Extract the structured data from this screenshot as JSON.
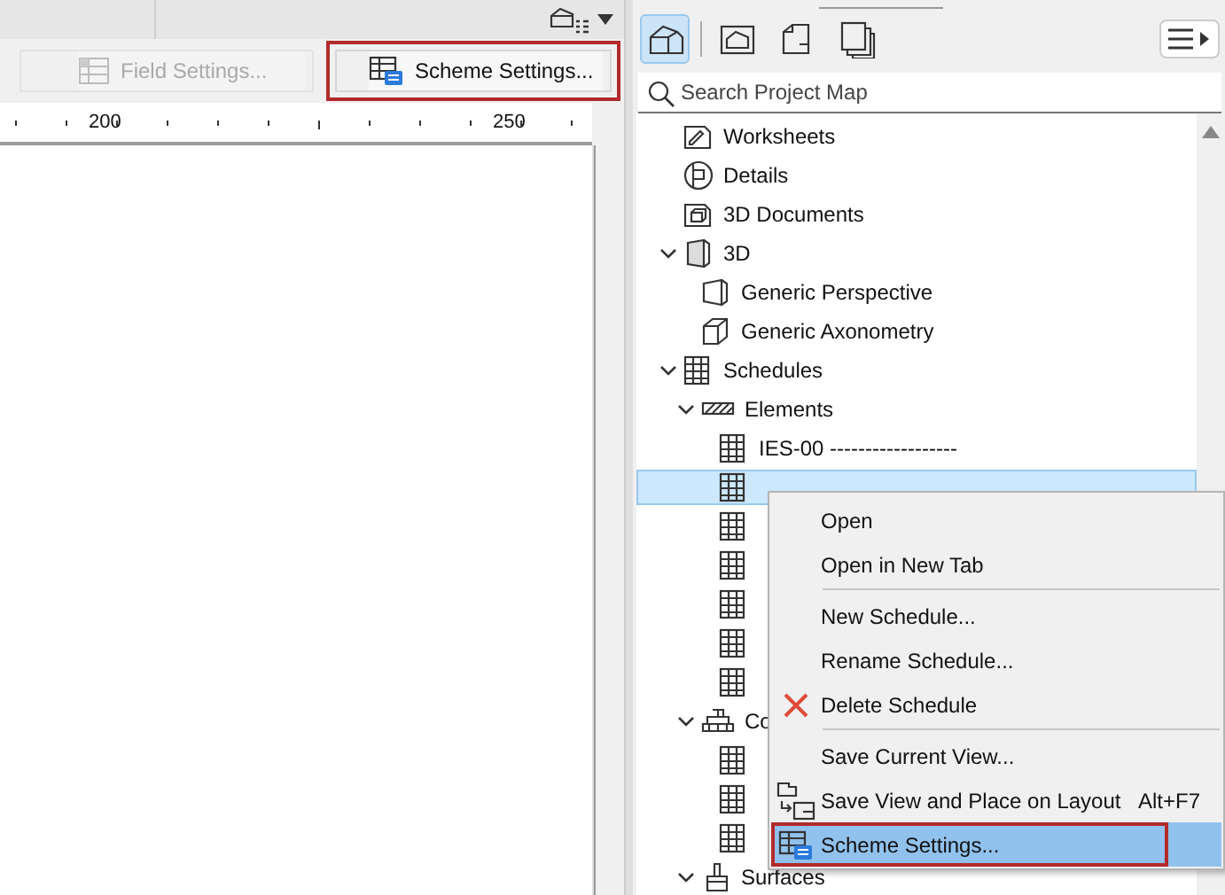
{
  "left_pane": {
    "buttons": [
      {
        "label": "Field Settings...",
        "disabled": true,
        "callout": false,
        "kind": "field"
      },
      {
        "label": "Scheme Settings...",
        "disabled": false,
        "callout": true,
        "kind": "scheme"
      }
    ],
    "ruler": {
      "labels": [
        "200",
        "250"
      ]
    }
  },
  "project_map": {
    "view_tabs": [
      {
        "selected": true,
        "kind": "project"
      },
      {
        "selected": false,
        "kind": "view"
      },
      {
        "selected": false,
        "kind": "layout"
      },
      {
        "selected": false,
        "kind": "publisher"
      }
    ],
    "search": {
      "placeholder": "Search Project Map"
    },
    "tree": [
      {
        "label": "Worksheets",
        "kind": "worksheet",
        "selected": false
      },
      {
        "label": "Details",
        "kind": "detail",
        "selected": false
      },
      {
        "label": "3D Documents",
        "kind": "doc3d",
        "selected": false
      },
      {
        "label": "3D",
        "kind": "view3d",
        "selected": false,
        "expanded": true,
        "children": [
          {
            "label": "Generic Perspective",
            "kind": "perspective",
            "selected": false
          },
          {
            "label": "Generic Axonometry",
            "kind": "axonometry",
            "selected": false
          }
        ]
      },
      {
        "label": "Schedules",
        "kind": "schedule",
        "selected": false,
        "expanded": true,
        "children": [
          {
            "label": "Elements",
            "kind": "hatch",
            "selected": false,
            "expanded": true,
            "children": [
              {
                "label": "IES-00 ------------------",
                "kind": "schedule",
                "selected": false
              },
              {
                "kind": "schedule",
                "selected": true
              },
              {
                "kind": "schedule",
                "selected": false
              },
              {
                "kind": "schedule",
                "selected": false
              },
              {
                "kind": "schedule",
                "selected": false
              },
              {
                "kind": "schedule",
                "selected": false
              },
              {
                "kind": "schedule",
                "selected": false
              }
            ]
          },
          {
            "label": "Co",
            "kind": "bricks",
            "selected": false,
            "expanded": true,
            "children": [
              {
                "kind": "schedule",
                "selected": false
              },
              {
                "kind": "schedule",
                "selected": false
              },
              {
                "kind": "schedule",
                "selected": false
              }
            ]
          },
          {
            "label": "Surfaces",
            "kind": "brush",
            "selected": false,
            "expanded": true
          }
        ]
      }
    ]
  },
  "context_menu": [
    {
      "kind": "plain",
      "label": "Open",
      "selected": false,
      "callout": false
    },
    {
      "kind": "plain",
      "label": "Open in New Tab",
      "selected": false,
      "callout": false
    },
    {
      "kind": "separator"
    },
    {
      "kind": "plain",
      "label": "New Schedule...",
      "selected": false,
      "callout": false
    },
    {
      "kind": "plain",
      "label": "Rename Schedule...",
      "selected": false,
      "callout": false
    },
    {
      "kind": "delete",
      "label": "Delete Schedule",
      "selected": false,
      "callout": false
    },
    {
      "kind": "separator"
    },
    {
      "kind": "plain",
      "label": "Save Current View...",
      "selected": false,
      "callout": false
    },
    {
      "kind": "place",
      "label": "Save View and Place on Layout",
      "shortcut": "Alt+F7",
      "selected": false,
      "callout": false
    },
    {
      "kind": "scheme",
      "label": "Scheme Settings...",
      "selected": true,
      "callout": true
    }
  ]
}
